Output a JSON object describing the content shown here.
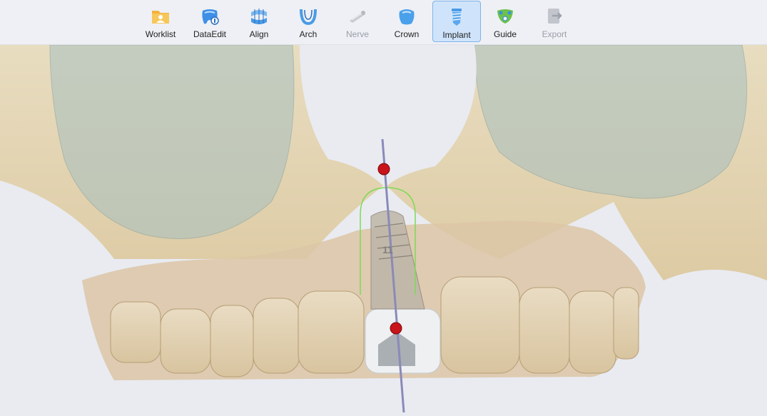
{
  "toolbar": {
    "items": [
      {
        "label": "Worklist",
        "icon": "worklist-folder-icon",
        "state": "enabled"
      },
      {
        "label": "DataEdit",
        "icon": "tooth-data-edit-icon",
        "state": "enabled"
      },
      {
        "label": "Align",
        "icon": "align-grid-icon",
        "state": "enabled"
      },
      {
        "label": "Arch",
        "icon": "arch-icon",
        "state": "enabled"
      },
      {
        "label": "Nerve",
        "icon": "nerve-icon",
        "state": "disabled"
      },
      {
        "label": "Crown",
        "icon": "crown-tooth-icon",
        "state": "enabled"
      },
      {
        "label": "Implant",
        "icon": "implant-screw-icon",
        "state": "active"
      },
      {
        "label": "Guide",
        "icon": "guide-icon",
        "state": "enabled"
      },
      {
        "label": "Export",
        "icon": "export-icon",
        "state": "disabled"
      }
    ]
  },
  "viewport": {
    "implant_label": "11"
  },
  "colors": {
    "active_bg": "#cfe4fb",
    "active_border": "#7fb2ea",
    "marker_red": "#c8141a",
    "safety_zone_green": "#7ed957",
    "axis_line": "#8a8ab8"
  }
}
